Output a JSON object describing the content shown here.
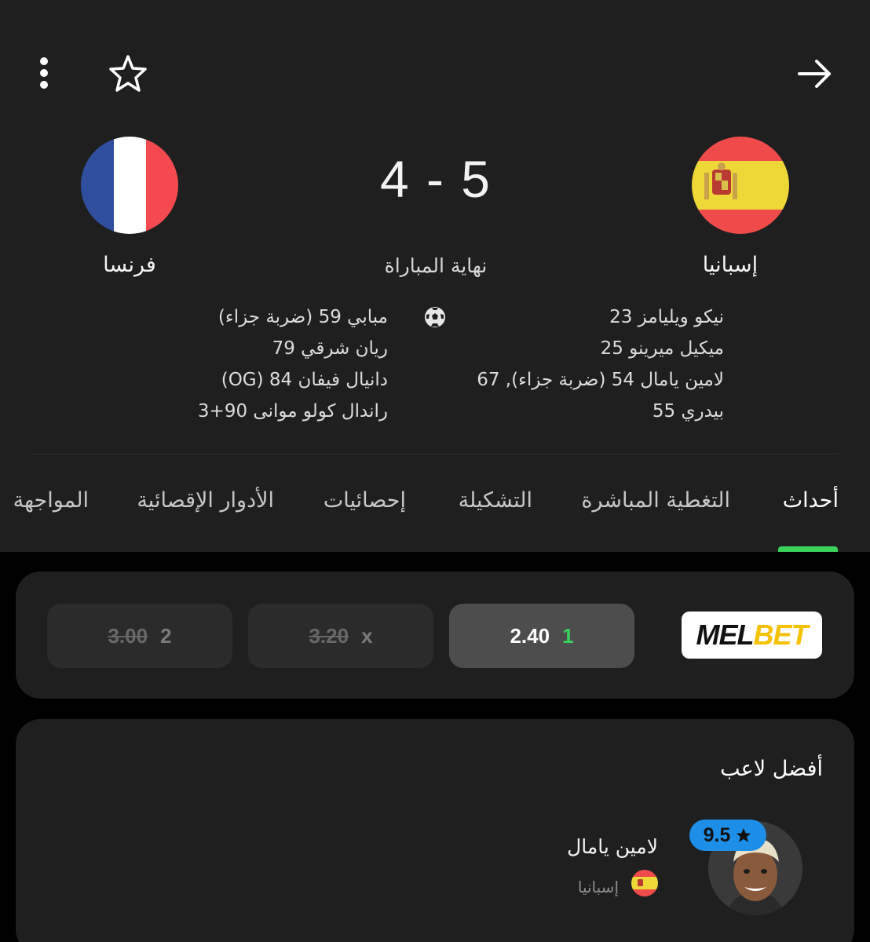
{
  "score": "4 - 5",
  "match_status": "نهاية المباراة",
  "teams": {
    "home": {
      "name": "إسبانيا"
    },
    "away": {
      "name": "فرنسا"
    }
  },
  "scorers": {
    "home": [
      "نيكو ويليامز 23",
      "ميكيل ميرينو 25",
      "لامين يامال 54 (ضربة جزاء), 67",
      "بيدري 55"
    ],
    "away": [
      "مبابي 59 (ضربة جزاء)",
      "ريان شرقي 79",
      "دانيال فيفان 84 (OG)",
      "راندال كولو موانى 90+3"
    ]
  },
  "tabs": {
    "events": "أحداث",
    "live_coverage": "التغطية المباشرة",
    "lineup": "التشكيلة",
    "stats": "إحصائيات",
    "knockout": "الأدوار الإقصائية",
    "head_to_head": "المواجهة"
  },
  "odds": {
    "provider_part1": "MEL",
    "provider_part2": "BET",
    "home": {
      "label": "1",
      "value": "2.40"
    },
    "draw": {
      "label": "x",
      "value": "3.20"
    },
    "away": {
      "label": "2",
      "value": "3.00"
    }
  },
  "best_player": {
    "title": "أفضل لاعب",
    "name": "لامين يامال",
    "team": "إسبانيا",
    "rating": "9.5"
  },
  "colors": {
    "accent_green": "#3ad35a",
    "rating_blue": "#1e8fe8",
    "background": "#1f1f1f"
  },
  "icons": [
    "more-vertical-icon",
    "star-icon",
    "arrow-right-icon",
    "soccer-ball-icon"
  ]
}
